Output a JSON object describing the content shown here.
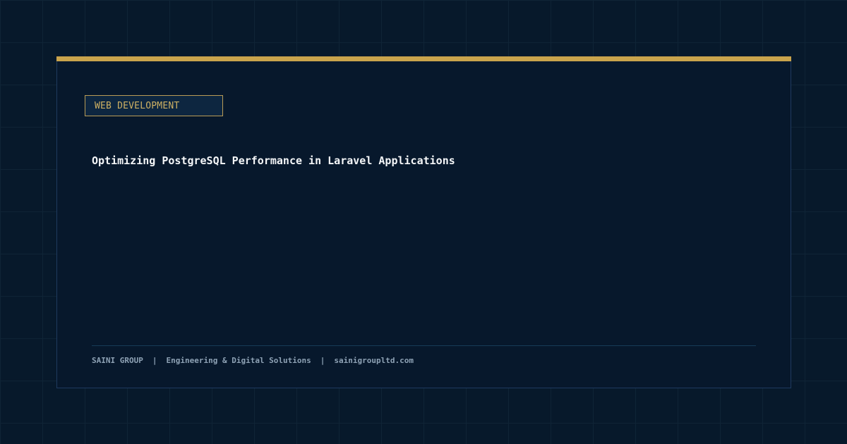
{
  "category": {
    "label": "WEB DEVELOPMENT"
  },
  "article": {
    "title": "Optimizing PostgreSQL Performance in Laravel Applications"
  },
  "footer": {
    "company": "SAINI GROUP",
    "tagline": "Engineering & Digital Solutions",
    "website": "sainigroupltd.com",
    "separator": "|"
  },
  "colors": {
    "background": "#07192b",
    "accent": "#c9a44c",
    "title_text": "#f4f6f8",
    "footer_text": "#8ea2b5"
  }
}
